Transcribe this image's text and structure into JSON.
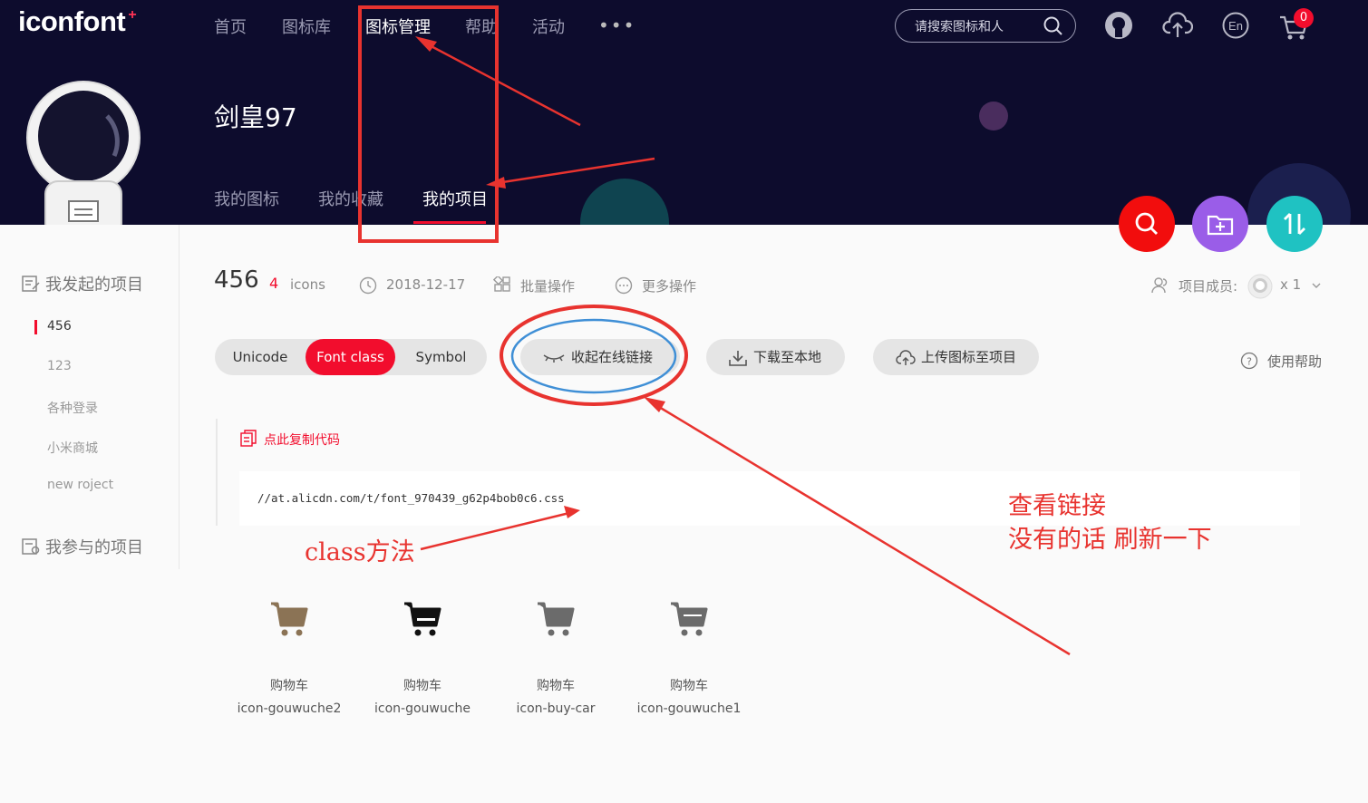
{
  "header": {
    "logo": "iconfont",
    "logo_plus": "+",
    "nav": [
      "首页",
      "图标库",
      "图标管理",
      "帮助",
      "活动"
    ],
    "nav_more": "•••",
    "search_placeholder": "请搜索图标和人",
    "cart_count": "0",
    "user_name": "剑皇97",
    "sub_tabs": [
      "我的图标",
      "我的收藏",
      "我的项目"
    ]
  },
  "sidebar": {
    "my_projects_title": "我发起的项目",
    "projects": [
      "456",
      "123",
      "各种登录",
      "小米商城",
      "new roject"
    ],
    "joined_title": "我参与的项目"
  },
  "project": {
    "name": "456",
    "count": "4",
    "count_unit": "icons",
    "date": "2018-12-17",
    "batch": "批量操作",
    "more": "更多操作",
    "members_label": "项目成员:",
    "members_count": "x 1"
  },
  "tabs": {
    "unicode": "Unicode",
    "font_class": "Font class",
    "symbol": "Symbol"
  },
  "actions": {
    "collapse_link": "收起在线链接",
    "download": "下载至本地",
    "upload": "上传图标至项目",
    "help": "使用帮助"
  },
  "code": {
    "copy_label": "点此复制代码",
    "url": "//at.alicdn.com/t/font_970439_g62p4bob0c6.css"
  },
  "icons": [
    {
      "name": "购物车",
      "code": "icon-gouwuche2",
      "color": "#8b7355"
    },
    {
      "name": "购物车",
      "code": "icon-gouwuche",
      "color": "#111111"
    },
    {
      "name": "购物车",
      "code": "icon-buy-car",
      "color": "#6b6b6b"
    },
    {
      "name": "购物车",
      "code": "icon-gouwuche1",
      "color": "#6b6b6b"
    }
  ],
  "annotations": {
    "class_method": "class方法",
    "view_link_line1": "查看链接",
    "view_link_line2": "没有的话 刷新一下"
  },
  "colors": {
    "accent": "#f20d2d",
    "header_bg": "#0d0c2d",
    "annotation": "#e8332f",
    "purple_btn": "#9a5de8",
    "teal_btn": "#1fc2c2"
  }
}
